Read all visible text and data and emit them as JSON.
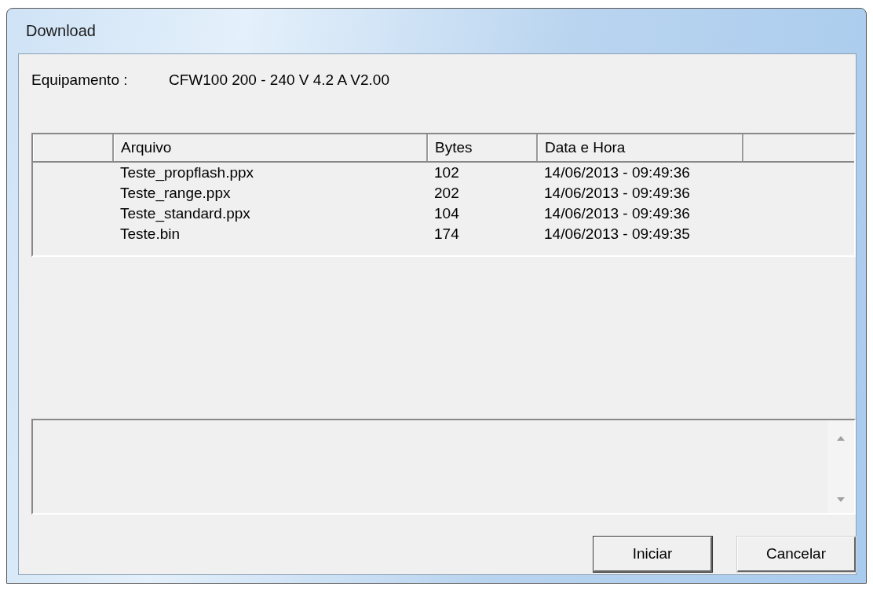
{
  "window": {
    "title": "Download"
  },
  "equipment": {
    "label": "Equipamento :",
    "value": "CFW100 200 - 240 V 4.2 A V2.00"
  },
  "table": {
    "columns": [
      "Arquivo",
      "Bytes",
      "Data e Hora"
    ],
    "rows": [
      {
        "arquivo": "Teste_propflash.ppx",
        "bytes": "102",
        "data_hora": "14/06/2013 - 09:49:36"
      },
      {
        "arquivo": "Teste_range.ppx",
        "bytes": "202",
        "data_hora": "14/06/2013 - 09:49:36"
      },
      {
        "arquivo": "Teste_standard.ppx",
        "bytes": "104",
        "data_hora": "14/06/2013 - 09:49:36"
      },
      {
        "arquivo": "Teste.bin",
        "bytes": "174",
        "data_hora": "14/06/2013 - 09:49:35"
      }
    ]
  },
  "buttons": [
    {
      "label": "Iniciar",
      "default": true
    },
    {
      "label": "Cancelar",
      "default": false
    }
  ]
}
